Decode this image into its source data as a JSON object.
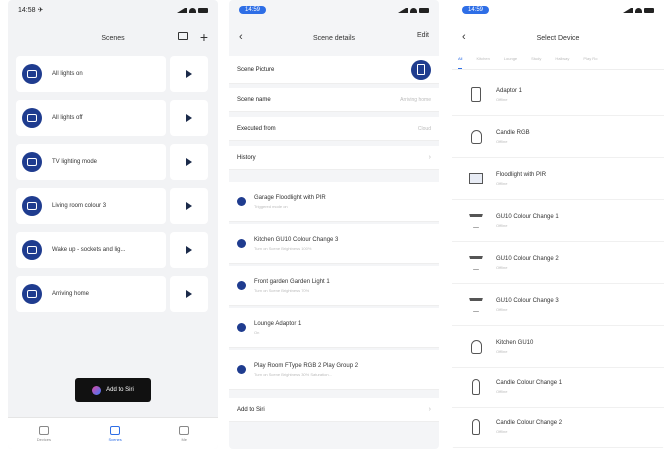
{
  "screen1": {
    "time": "14:58 ✈",
    "title": "Scenes",
    "scenes": [
      {
        "label": "All lights on"
      },
      {
        "label": "All lights off"
      },
      {
        "label": "TV lighting mode"
      },
      {
        "label": "Living room colour 3"
      },
      {
        "label": "Wake up - sockets and lig..."
      },
      {
        "label": "Arriving home"
      }
    ],
    "siri_button": "Add to Siri",
    "tabs": [
      {
        "label": "Devices"
      },
      {
        "label": "Scenes"
      },
      {
        "label": "Me"
      }
    ]
  },
  "screen2": {
    "time": "14:59",
    "title": "Scene details",
    "edit": "Edit",
    "fields": {
      "picture": "Scene Picture",
      "name_label": "Scene name",
      "name_value": "Arriving home",
      "executed_label": "Executed from",
      "executed_value": "Cloud",
      "history": "History"
    },
    "actions": [
      {
        "title": "Garage Floodlight with PIR",
        "sub": "Triggered mode on"
      },
      {
        "title": "Kitchen GU10 Colour Change 3",
        "sub": "Turn on Scene Brightness 100%"
      },
      {
        "title": "Front garden Garden Light 1",
        "sub": "Turn on Scene Brightness 70%"
      },
      {
        "title": "Lounge Adaptor 1",
        "sub": "On"
      },
      {
        "title": "Play Room FType RGB 2 Play Group 2",
        "sub": "Turn on Scene Brightness 30% Saturation..."
      }
    ],
    "add_to_siri": "Add to Siri"
  },
  "screen3": {
    "time": "14:59",
    "title": "Select Device",
    "categories": [
      "All",
      "Kitchen",
      "Lounge",
      "Study",
      "Hallway",
      "Play Ro"
    ],
    "devices": [
      {
        "name": "Adaptor 1",
        "status": "Offline",
        "icon": "plug-icon"
      },
      {
        "name": "Candle RGB",
        "status": "Offline",
        "icon": "bulb-icon"
      },
      {
        "name": "Floodlight with PIR",
        "status": "Offline",
        "icon": "floodlight-icon"
      },
      {
        "name": "GU10 Colour Change 1",
        "status": "Offline",
        "icon": "spotlight-icon"
      },
      {
        "name": "GU10 Colour Change 2",
        "status": "Offline",
        "icon": "spotlight-icon"
      },
      {
        "name": "GU10 Colour Change 3",
        "status": "Offline",
        "icon": "spotlight-icon"
      },
      {
        "name": "Kitchen GU10",
        "status": "Offline",
        "icon": "bulb-icon"
      },
      {
        "name": "Candle Colour Change 1",
        "status": "Offline",
        "icon": "candle-icon"
      },
      {
        "name": "Candle Colour Change 2",
        "status": "Offline",
        "icon": "candle-icon"
      }
    ]
  }
}
